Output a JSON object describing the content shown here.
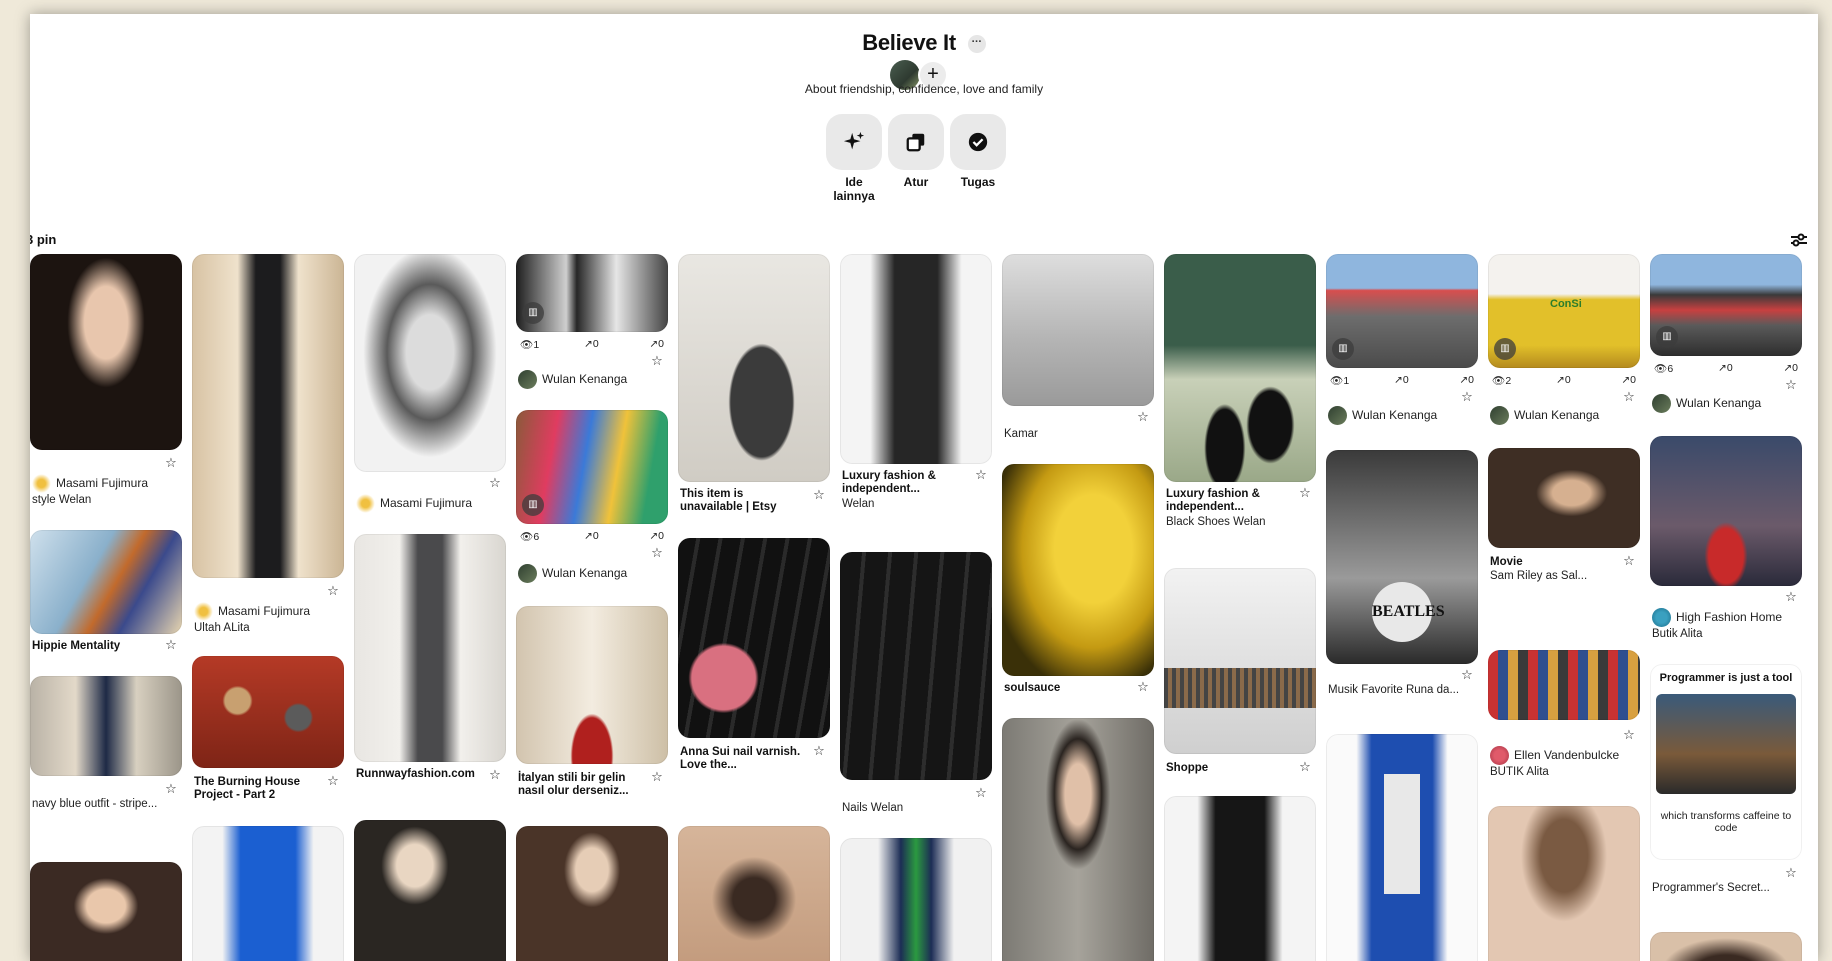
{
  "board": {
    "title": "Believe It",
    "more": "···",
    "add": "+",
    "description": "About friendship, confidence, love and family",
    "pin_count": "3 pin"
  },
  "tools": [
    {
      "label": "Ide lainnya",
      "icon": "sparkle-icon"
    },
    {
      "label": "Atur",
      "icon": "organize-icon"
    },
    {
      "label": "Tugas",
      "icon": "check-circle-icon"
    }
  ],
  "colors": {
    "background": "#efe9d9",
    "panel": "#ffffff",
    "tool_button": "#e9e9e9"
  },
  "pins": {
    "p1": {
      "owner": "Masami Fujimura",
      "sub": "style Welan"
    },
    "p2": {
      "title": "Hippie Mentality"
    },
    "p3": {
      "sub": "navy blue outfit - stripe..."
    },
    "p5": {
      "owner": "Masami Fujimura",
      "sub": "Ultah ALita"
    },
    "p6": {
      "title": "The Burning House Project - Part 2"
    },
    "p8": {
      "owner": "Masami Fujimura"
    },
    "p9": {
      "title": "Runnwayfashion.com"
    },
    "p11": {
      "views": "1",
      "saves": "0",
      "shares": "0",
      "owner": "Wulan Kenanga"
    },
    "p12": {
      "views": "6",
      "saves": "0",
      "shares": "0",
      "owner": "Wulan Kenanga"
    },
    "p13": {
      "title": "İtalyan stili bir gelin nasıl olur derseniz..."
    },
    "p15": {
      "title": "This item is unavailable | Etsy"
    },
    "p16": {
      "title": "Anna Sui nail varnish. Love the..."
    },
    "p18": {
      "title": "Luxury fashion & independent...",
      "sub": "Welan"
    },
    "p19": {
      "sub": "Nails Welan"
    },
    "p21": {
      "sub": "Kamar"
    },
    "p22": {
      "title": "soulsauce"
    },
    "p24": {
      "title": "Luxury fashion & independent...",
      "sub": "Black Shoes Welan"
    },
    "p25": {
      "title": "Shoppe"
    },
    "p27": {
      "views": "1",
      "saves": "0",
      "shares": "0",
      "owner": "Wulan Kenanga"
    },
    "p28": {
      "sub": "Musik Favorite Runa da..."
    },
    "p30": {
      "views": "2",
      "saves": "0",
      "shares": "0",
      "owner": "Wulan Kenanga"
    },
    "p31": {
      "title": "Movie",
      "sub": "Sam Riley as Sal..."
    },
    "p32": {
      "owner": "Ellen Vandenbulcke",
      "sub": "BUTIK Alita"
    },
    "p34": {
      "views": "6",
      "saves": "0",
      "shares": "0",
      "owner": "Wulan Kenanga"
    },
    "p35": {
      "owner": "High Fashion Home",
      "sub": "Butik Alita"
    },
    "p36": {
      "top": "Programmer is just a tool",
      "bottom": "which transforms caffeine to code",
      "sub": "Programmer's Secret..."
    },
    "beatles": "BEATLES",
    "consumer": "ConSi"
  }
}
